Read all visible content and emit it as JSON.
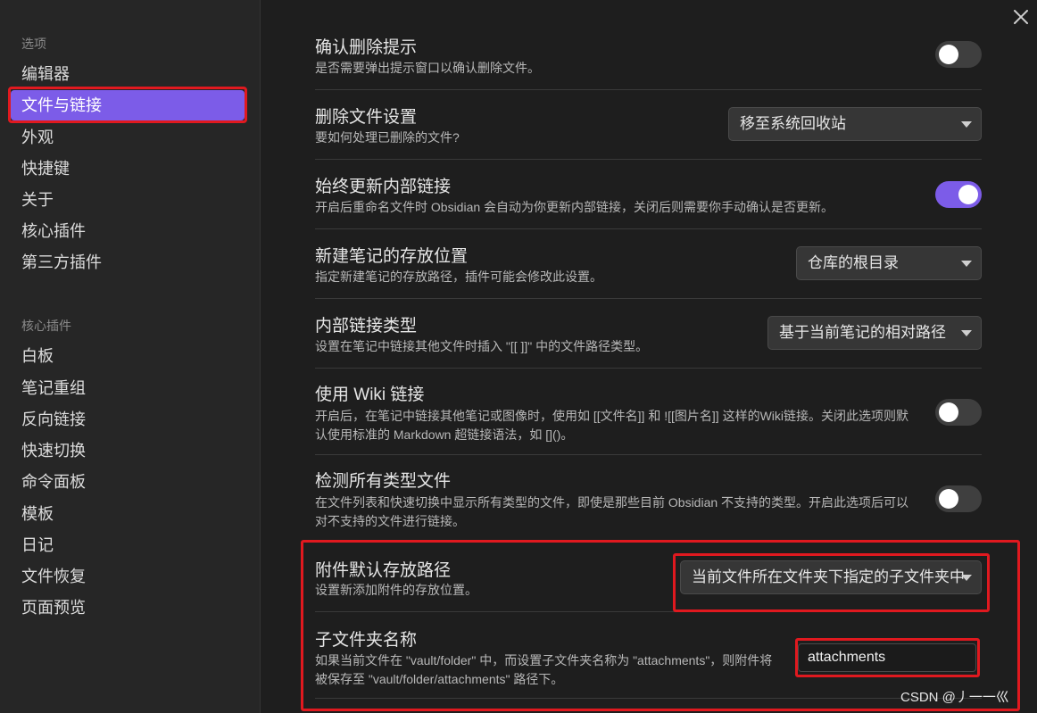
{
  "sidebar": {
    "options_heading": "选项",
    "options": [
      {
        "label": "编辑器"
      },
      {
        "label": "文件与链接"
      },
      {
        "label": "外观"
      },
      {
        "label": "快捷键"
      },
      {
        "label": "关于"
      },
      {
        "label": "核心插件"
      },
      {
        "label": "第三方插件"
      }
    ],
    "active_index": 1,
    "plugins_heading": "核心插件",
    "plugins": [
      {
        "label": "白板"
      },
      {
        "label": "笔记重组"
      },
      {
        "label": "反向链接"
      },
      {
        "label": "快速切换"
      },
      {
        "label": "命令面板"
      },
      {
        "label": "模板"
      },
      {
        "label": "日记"
      },
      {
        "label": "文件恢复"
      },
      {
        "label": "页面预览"
      }
    ]
  },
  "close_icon": "close-icon",
  "settings": [
    {
      "name": "确认删除提示",
      "desc": "是否需要弹出提示窗口以确认删除文件。",
      "control": "toggle",
      "on": false
    },
    {
      "name": "删除文件设置",
      "desc": "要如何处理已删除的文件?",
      "control": "dropdown",
      "value": "移至系统回收站"
    },
    {
      "name": "始终更新内部链接",
      "desc": "开启后重命名文件时 Obsidian 会自动为你更新内部链接，关闭后则需要你手动确认是否更新。",
      "control": "toggle",
      "on": true
    },
    {
      "name": "新建笔记的存放位置",
      "desc": "指定新建笔记的存放路径，插件可能会修改此设置。",
      "control": "dropdown",
      "value": "仓库的根目录"
    },
    {
      "name": "内部链接类型",
      "desc": "设置在笔记中链接其他文件时插入 \"[[ ]]\" 中的文件路径类型。",
      "control": "dropdown",
      "value": "基于当前笔记的相对路径"
    },
    {
      "name": "使用 Wiki 链接",
      "desc": "开启后，在笔记中链接其他笔记或图像时，使用如 [[文件名]] 和 ![[图片名]] 这样的Wiki链接。关闭此选项则默认使用标准的 Markdown 超链接语法，如 []()。",
      "control": "toggle",
      "on": false
    },
    {
      "name": "检测所有类型文件",
      "desc": "在文件列表和快速切换中显示所有类型的文件，即使是那些目前 Obsidian 不支持的类型。开启此选项后可以对不支持的文件进行链接。",
      "control": "toggle",
      "on": false
    },
    {
      "name": "附件默认存放路径",
      "desc": "设置新添加附件的存放位置。",
      "control": "dropdown",
      "value": "当前文件所在文件夹下指定的子文件夹中"
    },
    {
      "name": "子文件夹名称",
      "desc": "如果当前文件在 \"vault/folder\" 中，而设置子文件夹名称为 \"attachments\"，则附件将被保存至 \"vault/folder/attachments\" 路径下。",
      "control": "text",
      "value": "attachments"
    }
  ],
  "watermark": "CSDN @丿一一巛",
  "colors": {
    "accent": "#7c5ce8",
    "highlight": "#e0191f",
    "background": "#1e1e1e",
    "sidebar": "#262626"
  }
}
